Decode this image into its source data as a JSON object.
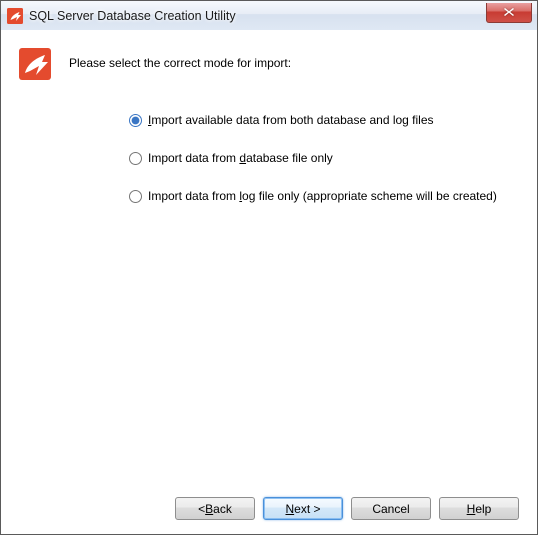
{
  "window": {
    "title": "SQL Server Database Creation Utility"
  },
  "instruction": "Please select the correct mode for import:",
  "options": [
    {
      "accel": "I",
      "rest": "mport available data from both database and log files",
      "selected": true
    },
    {
      "accel": "d",
      "pre": "Import data from ",
      "rest": "atabase file only",
      "selected": false
    },
    {
      "accel": "l",
      "pre": "Import data from ",
      "rest": "og file only (appropriate scheme will be created)",
      "selected": false
    }
  ],
  "buttons": {
    "back": {
      "pre": "< ",
      "accel": "B",
      "rest": "ack"
    },
    "next": {
      "accel": "N",
      "rest": "ext >"
    },
    "cancel": {
      "label": "Cancel"
    },
    "help": {
      "accel": "H",
      "rest": "elp"
    }
  }
}
